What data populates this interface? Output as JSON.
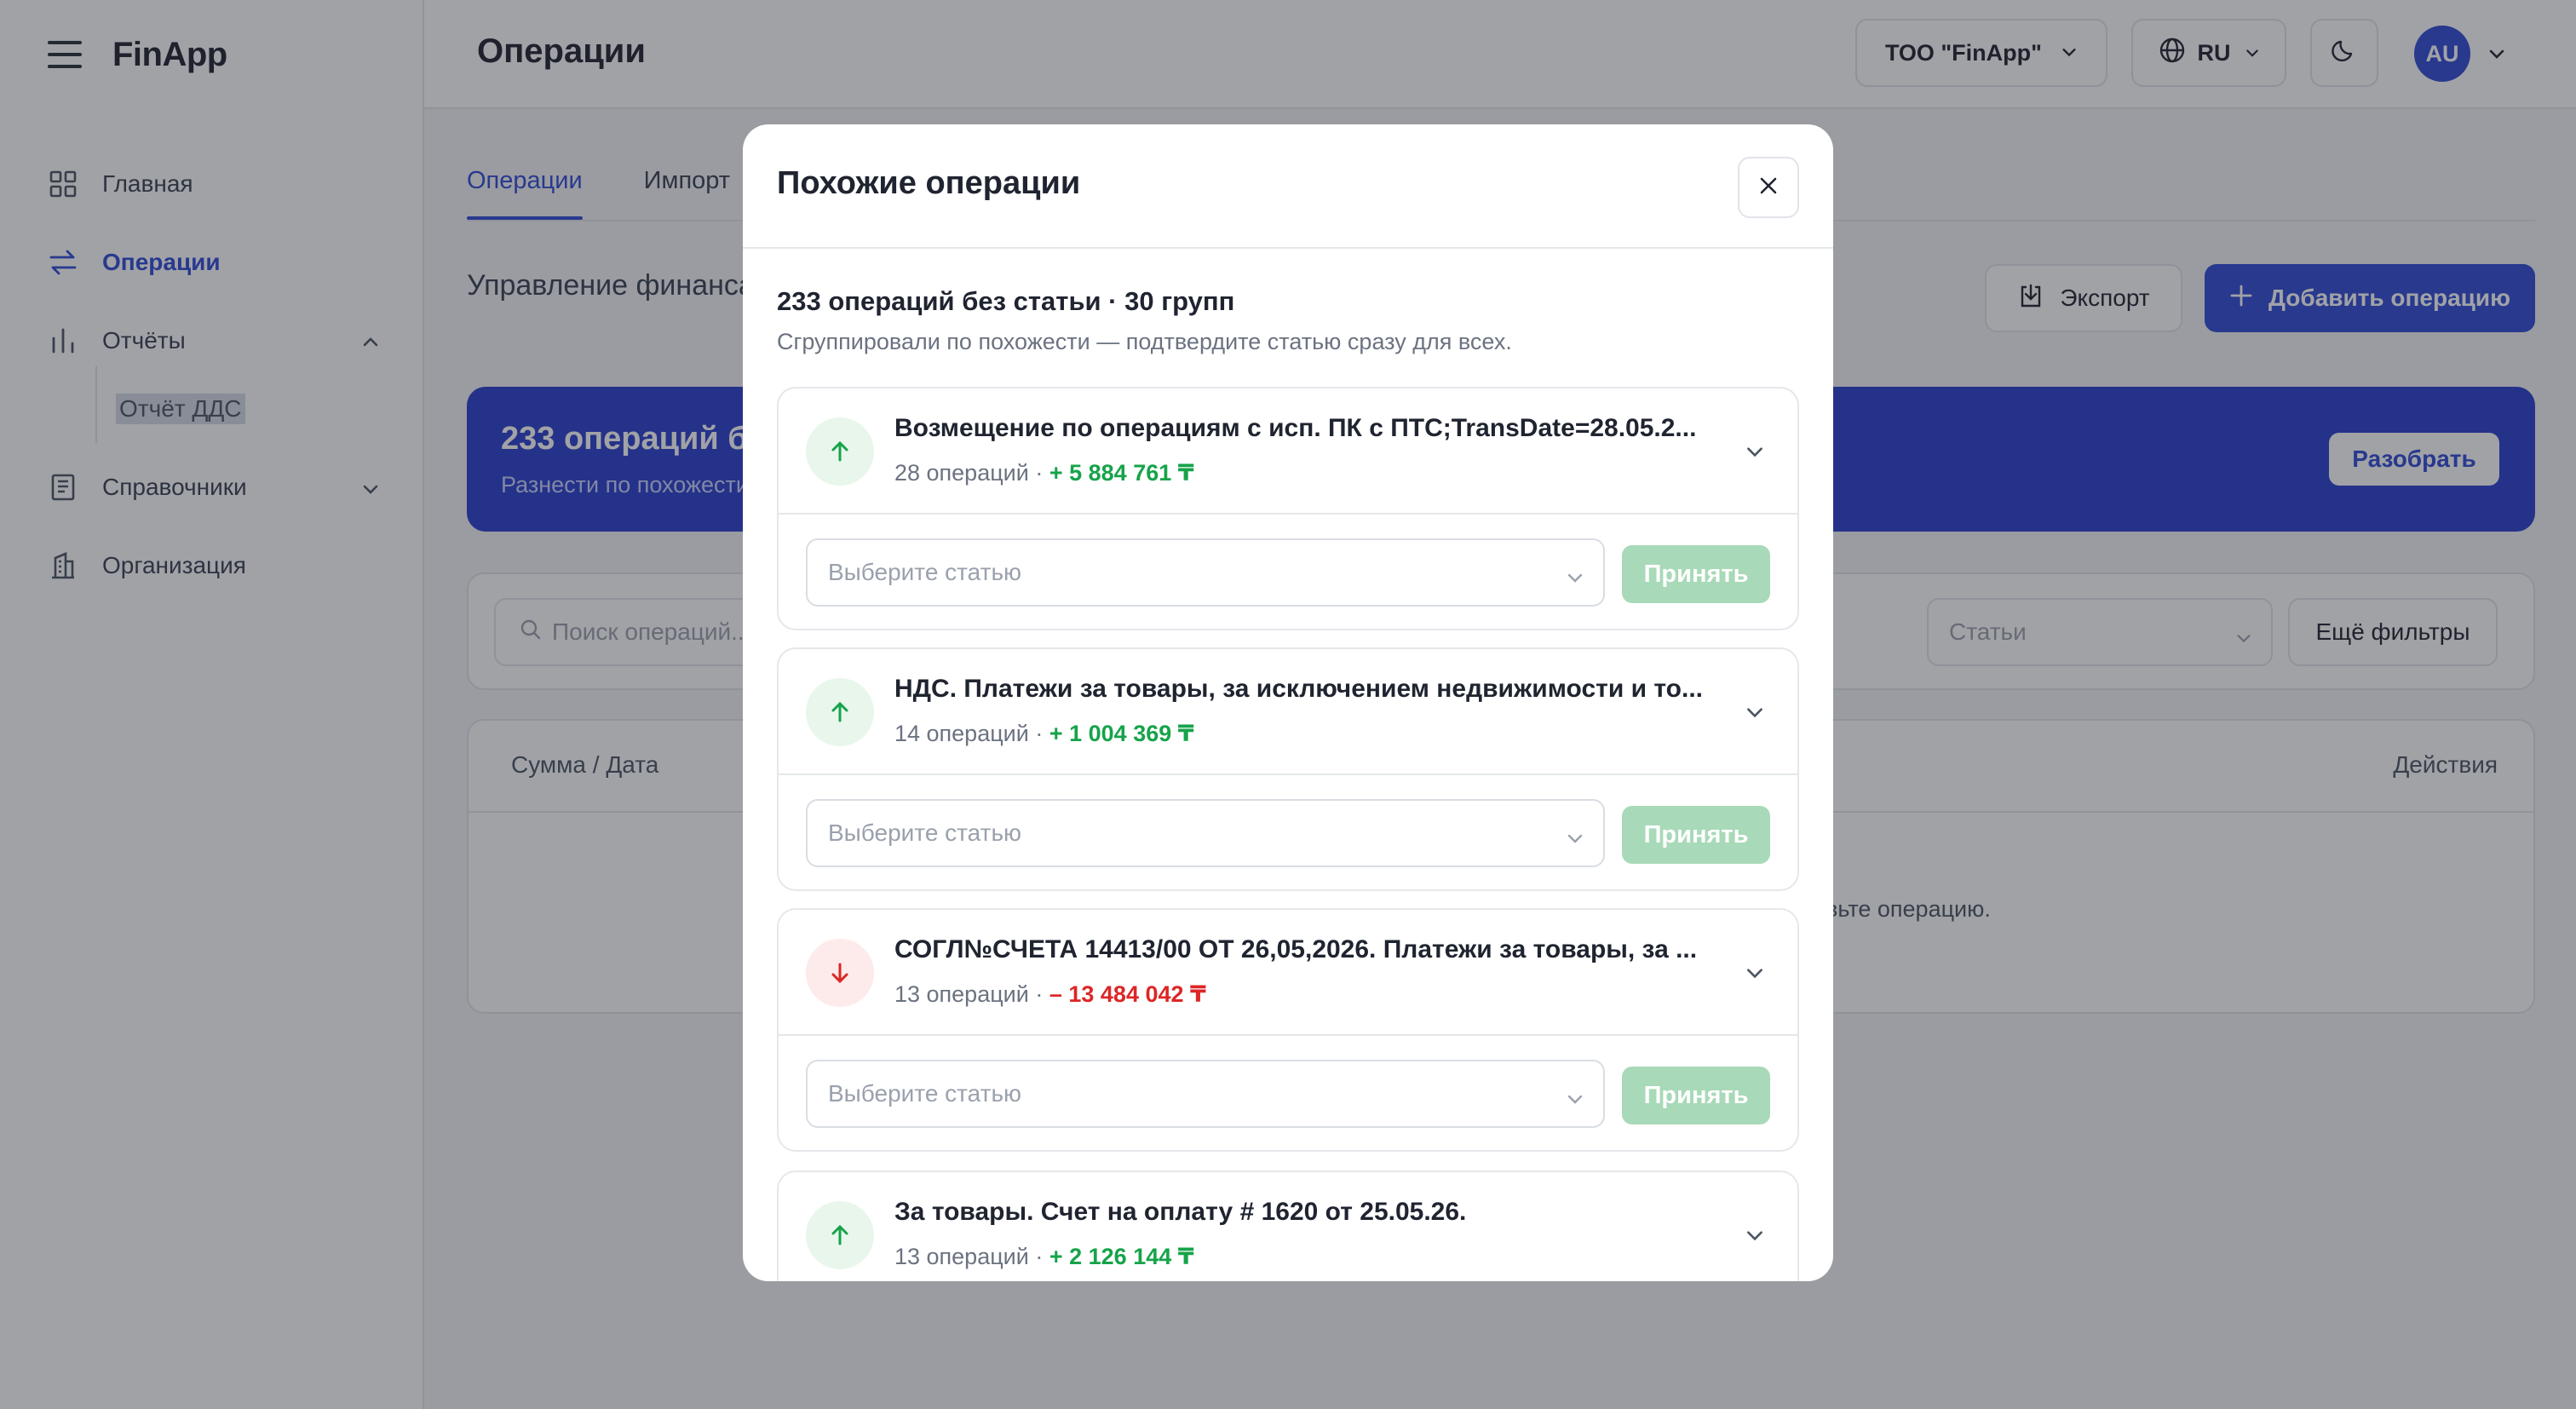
{
  "app": {
    "brand": "FinApp"
  },
  "sidebar": {
    "items": [
      {
        "label": "Главная",
        "icon": "grid-icon"
      },
      {
        "label": "Операции",
        "icon": "swap-icon",
        "active": true
      },
      {
        "label": "Отчёты",
        "icon": "bar-chart-icon",
        "expanded": true
      },
      {
        "label": "Отчёт ДДС",
        "sub": true
      },
      {
        "label": "Справочники",
        "icon": "book-icon"
      },
      {
        "label": "Организация",
        "icon": "building-icon"
      }
    ]
  },
  "header": {
    "title": "Операции",
    "org": "ТОО \"FinApp\"",
    "lang": "RU",
    "avatar": "AU"
  },
  "main": {
    "tabs": [
      {
        "label": "Операции"
      },
      {
        "label": "Импорт"
      }
    ],
    "section_title": "Управление финансами",
    "export_label": "Экспорт",
    "add_label": "Добавить операцию",
    "banner": {
      "title": "233 операций без статьи",
      "subtitle": "Разнести по похожести",
      "button": "Разобрать"
    },
    "filters": {
      "search_placeholder": "Поиск операций...",
      "articles": "Статьи",
      "more": "Ещё фильтры"
    },
    "table": {
      "col_left": "Сумма / Дата",
      "col_right": "Действия",
      "empty": "авьте операцию."
    }
  },
  "modal": {
    "title": "Похожие операции",
    "summary": "233 операций без статьи · 30 групп",
    "hint": "Сгруппировали по похожести — подтвердите статью сразу для всех.",
    "select_placeholder": "Выберите статью",
    "accept_label": "Принять",
    "groups": [
      {
        "title": "Возмещение по операциям с исп. ПК с ПТС;TransDate=28.05.2...",
        "count": "28 операций ·",
        "amount": "+ 5 884 761 ₸",
        "direction": "in"
      },
      {
        "title": "НДС. Платежи за товары, за исключением недвижимости и то...",
        "count": "14 операций ·",
        "amount": "+ 1 004 369 ₸",
        "direction": "in"
      },
      {
        "title": "СОГЛ№СЧЕТА 14413/00 ОТ 26,05,2026. Платежи за товары, за ...",
        "count": "13 операций ·",
        "amount": "– 13 484 042 ₸",
        "direction": "out"
      },
      {
        "title": "За товары. Счет на оплату # 1620 от 25.05.26.",
        "count": "13 операций ·",
        "amount": "+ 2 126 144 ₸",
        "direction": "in"
      }
    ]
  },
  "colors": {
    "accent": "#2f4bd6",
    "positive": "#16a34a",
    "negative": "#dc2626"
  }
}
